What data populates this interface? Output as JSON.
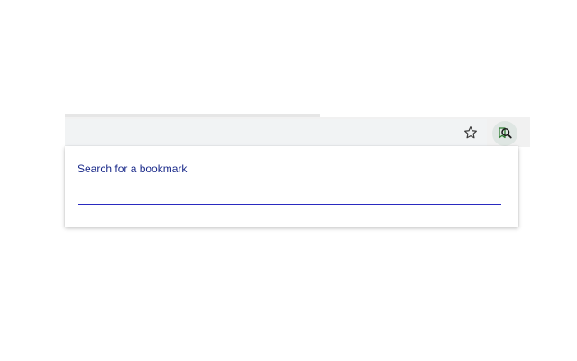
{
  "toolbar": {
    "star_icon": "star-outline-icon",
    "extension_icon": "bookmark-search-icon"
  },
  "popup": {
    "label": "Search for a bookmark",
    "search": {
      "value": "",
      "placeholder": ""
    }
  },
  "colors": {
    "label": "#1a2a8a",
    "input_underline": "#2a2ac0",
    "extension_button_bg": "#dfe6e3",
    "toolbar_bg": "#f1f1f1"
  }
}
